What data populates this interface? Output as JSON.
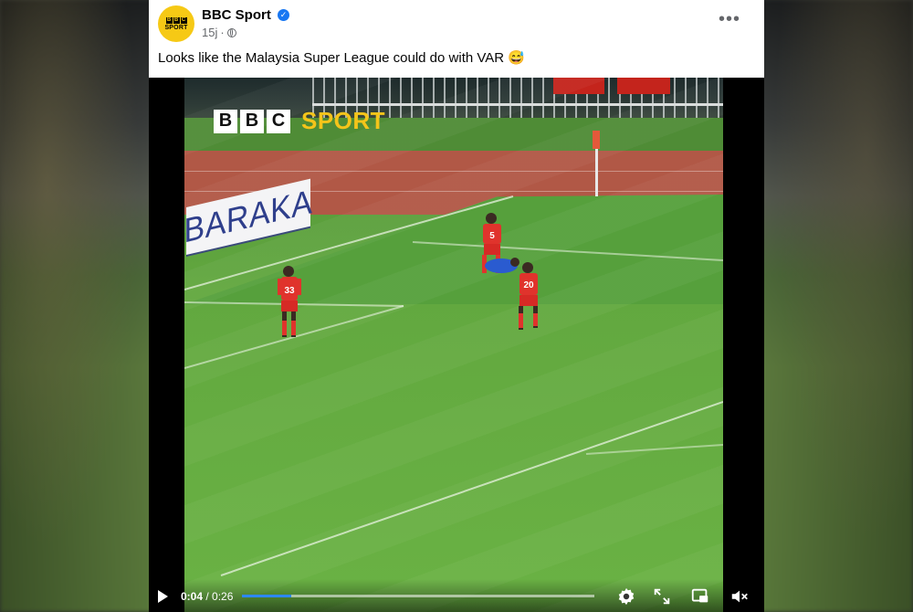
{
  "post": {
    "page_name": "BBC Sport",
    "avatar_top": "BBC",
    "avatar_bottom": "SPORT",
    "time": "15j",
    "separator": "·",
    "more_label": "•••",
    "caption": "Looks like the Malaysia Super League could do with VAR 😅"
  },
  "video": {
    "logo_letters": [
      "B",
      "B",
      "C"
    ],
    "logo_word": "SPORT",
    "board_text": "BARAKA",
    "players": [
      {
        "number": "33"
      },
      {
        "number": "5"
      },
      {
        "number": "20"
      }
    ],
    "time_current": "0:04",
    "time_sep": " / ",
    "time_total": "0:26",
    "progress": 0.14
  },
  "colors": {
    "accent": "#1877f2",
    "bbc_yellow": "#f4c41a",
    "kit_red": "#e0332c"
  },
  "icons": [
    "verified-icon",
    "globe-icon",
    "play-icon",
    "settings-icon",
    "fullscreen-icon",
    "pip-icon",
    "volume-icon"
  ]
}
